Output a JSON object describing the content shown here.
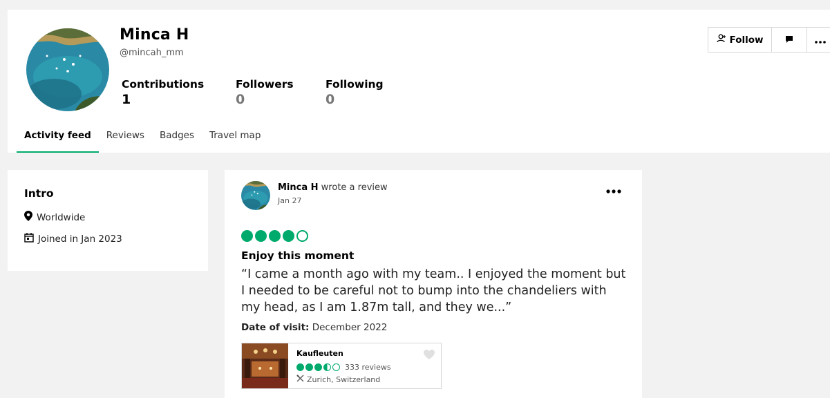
{
  "profile": {
    "name": "Minca H",
    "handle": "@mincah_mm",
    "stats": [
      {
        "label": "Contributions",
        "value": "1"
      },
      {
        "label": "Followers",
        "value": "0"
      },
      {
        "label": "Following",
        "value": "0"
      }
    ],
    "avatar_icon": "coastal-bay-photo"
  },
  "actions": {
    "follow_label": "Follow",
    "follow_icon": "add-user-icon",
    "message_icon": "message-icon",
    "more_icon": "more-horizontal-icon"
  },
  "tabs": [
    {
      "label": "Activity feed",
      "active": true
    },
    {
      "label": "Reviews",
      "active": false
    },
    {
      "label": "Badges",
      "active": false
    },
    {
      "label": "Travel map",
      "active": false
    }
  ],
  "intro": {
    "title": "Intro",
    "location": "Worldwide",
    "joined": "Joined in Jan 2023"
  },
  "review": {
    "author": "Minca H",
    "action": " wrote a review",
    "date": "Jan 27",
    "rating": 4,
    "title": "Enjoy this moment",
    "text": "“I came a month ago with my team.. I enjoyed the moment but I needed to be careful not to bump into the chandeliers with my head, as I am 1.87m tall, and they we...”",
    "visit_label": "Date of visit:",
    "visit_value": " December 2022",
    "place": {
      "name": "Kaufleuten",
      "rating": 3.5,
      "reviews": "333 reviews",
      "location": "Zurich, Switzerland",
      "category_icon": "restaurant-icon"
    }
  },
  "colors": {
    "accent": "#00aa6c",
    "background": "#f2f2f2"
  }
}
